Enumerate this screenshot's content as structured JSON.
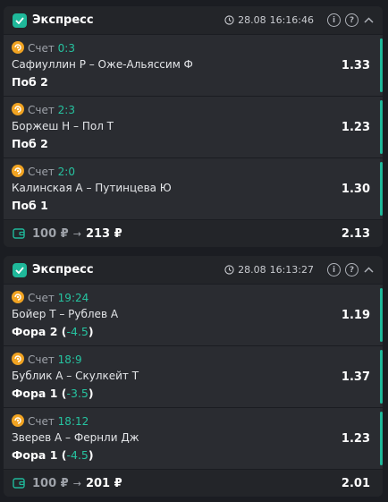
{
  "cards": [
    {
      "title": "Экспресс",
      "date": "28.08",
      "time": "16:16:46",
      "info_icon": "info-icon",
      "help_icon": "help-icon",
      "bets": [
        {
          "score_label": "Счет",
          "score": "0:3",
          "teams": "Сафиуллин Р – Оже-Альяссим Ф",
          "market": "Поб 2",
          "handicap": "",
          "odds": "1.33"
        },
        {
          "score_label": "Счет",
          "score": "2:3",
          "teams": "Боржеш Н – Пол Т",
          "market": "Поб 2",
          "handicap": "",
          "odds": "1.23"
        },
        {
          "score_label": "Счет",
          "score": "2:0",
          "teams": "Калинская А – Путинцева Ю",
          "market": "Поб 1",
          "handicap": "",
          "odds": "1.30"
        }
      ],
      "stake": "100 ₽",
      "arrow": "→",
      "payout": "213 ₽",
      "total_odds": "2.13"
    },
    {
      "title": "Экспресс",
      "date": "28.08",
      "time": "16:13:27",
      "info_icon": "info-icon",
      "help_icon": "help-icon",
      "bets": [
        {
          "score_label": "Счет",
          "score": "19:24",
          "teams": "Бойер Т – Рублев А",
          "market": "Фора 2 (",
          "handicap": "-4.5",
          "market_end": ")",
          "odds": "1.19"
        },
        {
          "score_label": "Счет",
          "score": "18:9",
          "teams": "Бублик А – Скулкейт Т",
          "market": "Фора 1 (",
          "handicap": "-3.5",
          "market_end": ")",
          "odds": "1.37"
        },
        {
          "score_label": "Счет",
          "score": "18:12",
          "teams": "Зверев А – Фернли Дж",
          "market": "Фора 1 (",
          "handicap": "-4.5",
          "market_end": ")",
          "odds": "1.23"
        }
      ],
      "stake": "100 ₽",
      "arrow": "→",
      "payout": "201 ₽",
      "total_odds": "2.01"
    }
  ],
  "colors": {
    "accent": "#1fb89a",
    "score": "#26c3a0",
    "live_badge": "#f0a322",
    "background": "#1b1d22"
  }
}
